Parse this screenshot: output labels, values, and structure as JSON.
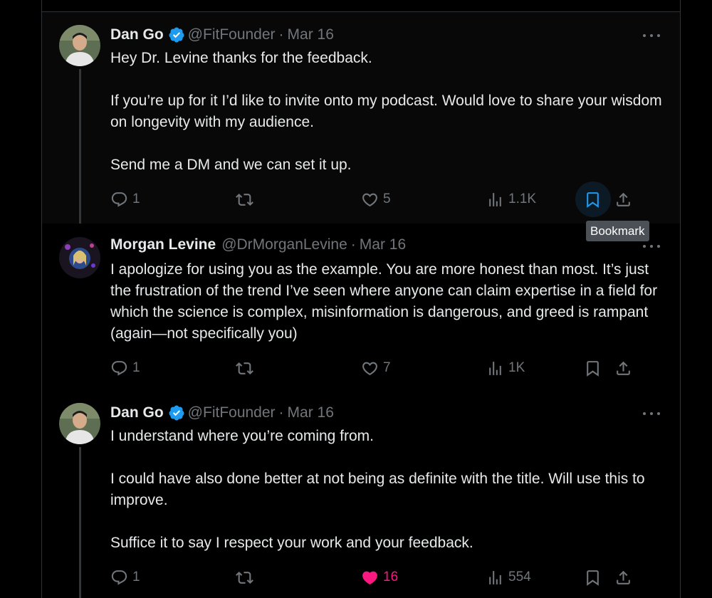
{
  "colors": {
    "background": "#000000",
    "text": "#e7e9ea",
    "muted": "#71767b",
    "verified": "#1d9bf0",
    "like": "#f91880",
    "bookmark_hover": "#1d9bf0"
  },
  "tweets": [
    {
      "name": "Dan Go",
      "verified": true,
      "handle": "@FitFounder",
      "separator": "·",
      "date": "Mar 16",
      "paragraphs": [
        "Hey Dr. Levine thanks for the feedback.",
        "If you’re up for it I’d like to invite onto my podcast. Would love to share your wisdom on longevity with my audience.",
        "Send me a DM and we can set it up."
      ],
      "replies": "1",
      "likes": "5",
      "views": "1.1K",
      "liked": false
    },
    {
      "name": "Morgan Levine",
      "verified": false,
      "handle": "@DrMorganLevine",
      "separator": "·",
      "date": "Mar 16",
      "paragraphs": [
        "I apologize for using you as the example. You are  more honest than most. It’s just the frustration of the trend I’ve seen where anyone can claim expertise in a field for which the science is complex, misinformation is dangerous, and greed is rampant (again—not specifically you)"
      ],
      "replies": "1",
      "likes": "7",
      "views": "1K",
      "liked": false
    },
    {
      "name": "Dan Go",
      "verified": true,
      "handle": "@FitFounder",
      "separator": "·",
      "date": "Mar 16",
      "paragraphs": [
        "I understand where you’re coming from.",
        "I could have also done better at not being as definite with the title. Will use this to improve.",
        "Suffice it to say I respect your work and your feedback."
      ],
      "replies": "1",
      "likes": "16",
      "views": "554",
      "liked": true
    }
  ],
  "tooltip": {
    "label": "Bookmark"
  },
  "icons": {
    "reply": "reply-icon",
    "retweet": "retweet-icon",
    "like": "heart-icon",
    "views": "views-icon",
    "bookmark": "bookmark-icon",
    "share": "share-icon",
    "more": "more-icon"
  }
}
